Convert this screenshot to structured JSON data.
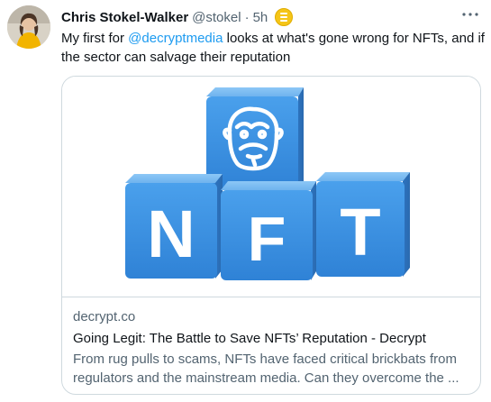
{
  "author": {
    "name": "Chris Stokel-Walker",
    "handle": "@stokel",
    "separator": "·",
    "time": "5h"
  },
  "tweet": {
    "text_before": "My first for ",
    "mention": "@decryptmedia",
    "text_after": " looks at what's gone wrong for NFTs, and if the sector can salvage their reputation"
  },
  "card": {
    "domain": "decrypt.co",
    "title": "Going Legit: The Battle to Save NFTs’ Reputation - Decrypt",
    "description": "From rug pulls to scams, NFTs have faced critical brickbats from regulators and the mainstream media. Can they overcome the ...",
    "cube_letters": [
      "N",
      "F",
      "T"
    ]
  },
  "icons": {
    "more": "more-options-icon",
    "coin": "coin-badge-icon"
  },
  "colors": {
    "link": "#1d9bf0",
    "secondary_text": "#536471",
    "cube_blue": "#3f95e4",
    "coin": "#f5c518"
  }
}
